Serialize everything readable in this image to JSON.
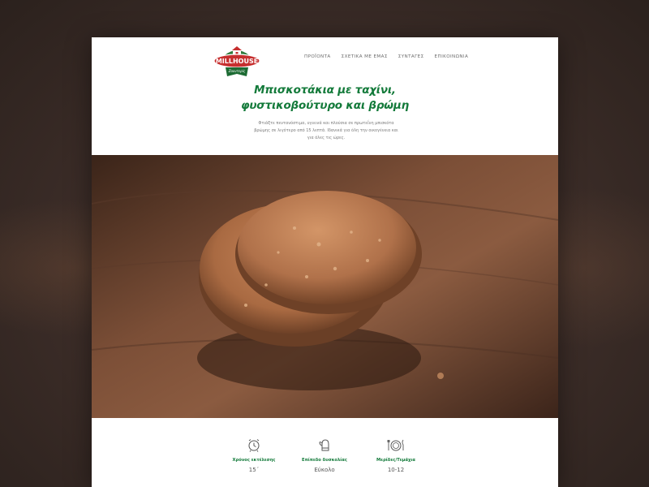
{
  "brand": {
    "name": "MILLHOUSE",
    "tagline": "Ζουντερίς"
  },
  "nav": {
    "items": [
      {
        "label": "ΠΡΟΪΟΝΤΑ"
      },
      {
        "label": "ΣΧΕΤΙΚΑ ΜΕ ΕΜΑΣ"
      },
      {
        "label": "ΣΥΝΤΑΓΕΣ"
      },
      {
        "label": "ΕΠΙΚΟΙΝΩΝΙΑ"
      }
    ]
  },
  "recipe": {
    "title_line1": "Μπισκοτάκια με ταχίνι,",
    "title_line2": "φυστικοβούτυρο και βρώμη",
    "description": "Φτιάξτε πεντανόστιμα, υγιεινά και πλούσια σε πρωτεΐνη μπισκότα βρώμης σε λιγότερο από 15 λεπτά. Ιδανικά για όλη την οικογένεια και για όλες τις ώρες."
  },
  "stats": [
    {
      "icon": "alarm-clock-icon",
      "label": "Χρόνος εκτέλεσης",
      "value": "15΄"
    },
    {
      "icon": "oven-mitt-icon",
      "label": "Επίπεδο δυσκολίας",
      "value": "Εύκολο"
    },
    {
      "icon": "plate-cutlery-icon",
      "label": "Μερίδες/Τεμάχια",
      "value": "10-12"
    }
  ],
  "colors": {
    "accent": "#137a3a",
    "logo_red": "#c62f2f",
    "background": "#3f2f2a"
  }
}
